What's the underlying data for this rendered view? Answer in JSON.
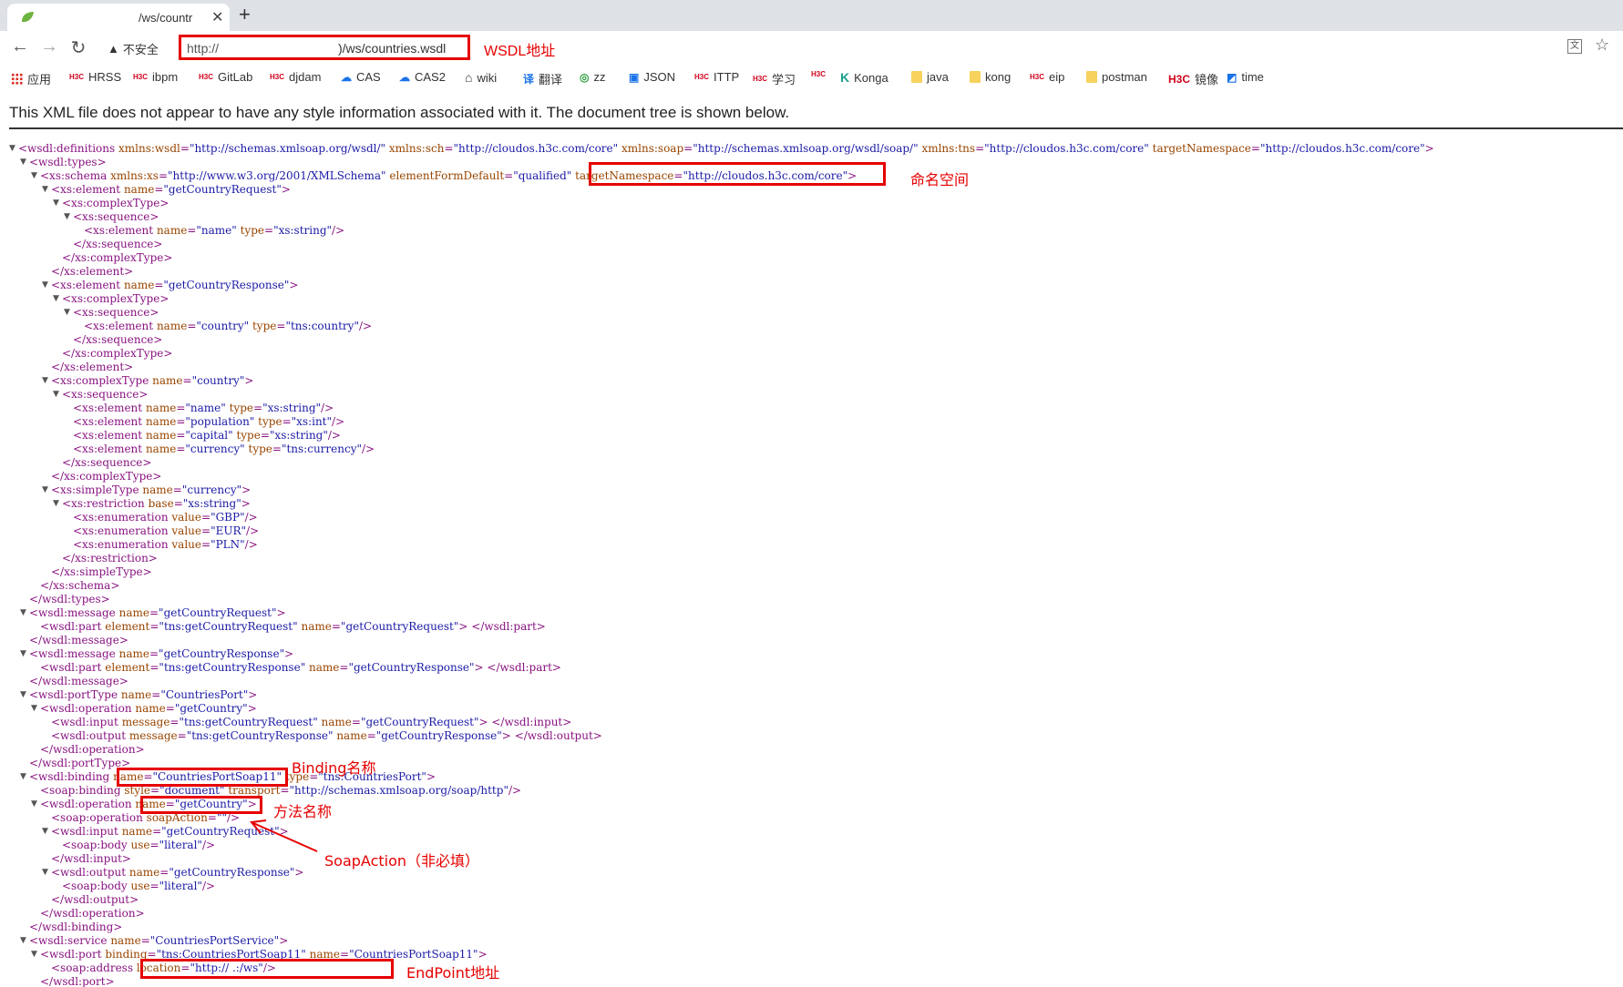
{
  "tab": {
    "title": "/ws/countr"
  },
  "toolbar": {
    "security_label": "不安全",
    "url_prefix": "http://",
    "url_suffix": ")/ws/countries.wsdl",
    "annotation": "WSDL地址"
  },
  "bookmarks": [
    {
      "label": "应用",
      "icon": "apps-icon"
    },
    {
      "label": "HRSS",
      "icon": "h3c-icon"
    },
    {
      "label": "ibpm",
      "icon": "h3c-icon"
    },
    {
      "label": "GitLab",
      "icon": "h3c-icon"
    },
    {
      "label": "djdam",
      "icon": "h3c-icon"
    },
    {
      "label": "CAS",
      "icon": "cloud-icon"
    },
    {
      "label": "CAS2",
      "icon": "cloud-icon"
    },
    {
      "label": "wiki",
      "icon": "house-icon"
    },
    {
      "label": "翻译",
      "icon": "translate-icon"
    },
    {
      "label": "zz",
      "icon": "zz-icon"
    },
    {
      "label": "JSON",
      "icon": "json-icon"
    },
    {
      "label": "ITTP",
      "icon": "h3c-icon"
    },
    {
      "label": "学习",
      "icon": "h3c-icon"
    },
    {
      "label": "",
      "icon": "h3c-icon"
    },
    {
      "label": "Konga",
      "icon": "konga-icon"
    },
    {
      "label": "java",
      "icon": "folder-icon"
    },
    {
      "label": "kong",
      "icon": "folder-icon"
    },
    {
      "label": "eip",
      "icon": "h3c-icon"
    },
    {
      "label": "postman",
      "icon": "folder-icon"
    },
    {
      "label": "镜像",
      "icon": "h3c-logo-icon"
    },
    {
      "label": "time",
      "icon": "time-icon"
    }
  ],
  "info_line": "This XML file does not appear to have any style information associated with it. The document tree is shown below.",
  "xml_lines": [
    "<wsdl:definitions xmlns:wsdl=\"http://schemas.xmlsoap.org/wsdl/\" xmlns:sch=\"http://cloudos.h3c.com/core\" xmlns:soap=\"http://schemas.xmlsoap.org/wsdl/soap/\" xmlns:tns=\"http://cloudos.h3c.com/core\" targetNamespace=\"http://cloudos.h3c.com/core\">",
    "<wsdl:types>",
    "<xs:schema xmlns:xs=\"http://www.w3.org/2001/XMLSchema\" elementFormDefault=\"qualified\" targetNamespace=\"http://cloudos.h3c.com/core\">",
    "<xs:element name=\"getCountryRequest\">",
    "<xs:complexType>",
    "<xs:sequence>",
    "<xs:element name=\"name\" type=\"xs:string\"/>",
    "</xs:sequence>",
    "</xs:complexType>",
    "</xs:element>",
    "<xs:element name=\"getCountryResponse\">",
    "<xs:complexType>",
    "<xs:sequence>",
    "<xs:element name=\"country\" type=\"tns:country\"/>",
    "</xs:sequence>",
    "</xs:complexType>",
    "</xs:element>",
    "<xs:complexType name=\"country\">",
    "<xs:sequence>",
    "<xs:element name=\"name\" type=\"xs:string\"/>",
    "<xs:element name=\"population\" type=\"xs:int\"/>",
    "<xs:element name=\"capital\" type=\"xs:string\"/>",
    "<xs:element name=\"currency\" type=\"tns:currency\"/>",
    "</xs:sequence>",
    "</xs:complexType>",
    "<xs:simpleType name=\"currency\">",
    "<xs:restriction base=\"xs:string\">",
    "<xs:enumeration value=\"GBP\"/>",
    "<xs:enumeration value=\"EUR\"/>",
    "<xs:enumeration value=\"PLN\"/>",
    "</xs:restriction>",
    "</xs:simpleType>",
    "</xs:schema>",
    "</wsdl:types>",
    "<wsdl:message name=\"getCountryRequest\">",
    "<wsdl:part element=\"tns:getCountryRequest\" name=\"getCountryRequest\"> </wsdl:part>",
    "</wsdl:message>",
    "<wsdl:message name=\"getCountryResponse\">",
    "<wsdl:part element=\"tns:getCountryResponse\" name=\"getCountryResponse\"> </wsdl:part>",
    "</wsdl:message>",
    "<wsdl:portType name=\"CountriesPort\">",
    "<wsdl:operation name=\"getCountry\">",
    "<wsdl:input message=\"tns:getCountryRequest\" name=\"getCountryRequest\"> </wsdl:input>",
    "<wsdl:output message=\"tns:getCountryResponse\" name=\"getCountryResponse\"> </wsdl:output>",
    "</wsdl:operation>",
    "</wsdl:portType>",
    "<wsdl:binding name=\"CountriesPortSoap11\" type=\"tns:CountriesPort\">",
    "<soap:binding style=\"document\" transport=\"http://schemas.xmlsoap.org/soap/http\"/>",
    "<wsdl:operation name=\"getCountry\">",
    "<soap:operation soapAction=\"\"/>",
    "<wsdl:input name=\"getCountryRequest\">",
    "<soap:body use=\"literal\"/>",
    "</wsdl:input>",
    "<wsdl:output name=\"getCountryResponse\">",
    "<soap:body use=\"literal\"/>",
    "</wsdl:output>",
    "</wsdl:operation>",
    "</wsdl:binding>",
    "<wsdl:service name=\"CountriesPortService\">",
    "<wsdl:port binding=\"tns:CountriesPortSoap11\" name=\"CountriesPortSoap11\">",
    "<soap:address location=\"http:// .:/ws\"/>",
    "</wsdl:port>"
  ],
  "annotations": {
    "namespace": "命名空间",
    "binding": "Binding名称",
    "method": "方法名称",
    "soap_action": "SoapAction（非必填）",
    "endpoint": "EndPoint地址"
  },
  "colors": {
    "annotation_red": "#e60000",
    "tag": "#881280",
    "attr_name": "#994500",
    "attr_value": "#1a1aa6"
  }
}
